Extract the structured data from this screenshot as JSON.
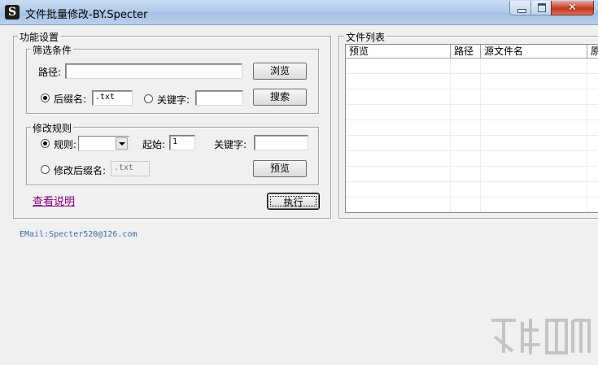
{
  "window": {
    "title": "文件批量修改-BY.Specter",
    "icon": "S-logo-icon",
    "controls": {
      "minimize": "minimize-icon",
      "maximize": "maximize-icon",
      "close": "✕"
    }
  },
  "function_settings": {
    "legend": "功能设置",
    "filter": {
      "legend": "筛选条件",
      "path_label": "路径:",
      "path_value": "",
      "browse_button": "浏览",
      "ext_radio_label": "后缀名:",
      "ext_radio_checked": true,
      "ext_value": ".txt",
      "keyword_radio_label": "关键字:",
      "keyword_radio_checked": false,
      "keyword_value": "",
      "search_button": "搜索"
    },
    "modify": {
      "legend": "修改规则",
      "rule_radio_label": "规则:",
      "rule_radio_checked": true,
      "rule_value": "",
      "start_label": "起始:",
      "start_value": "1",
      "keyword_label": "关键字:",
      "keyword_value": "",
      "ext_radio_label": "修改后缀名:",
      "ext_radio_checked": false,
      "ext_value": ".txt",
      "preview_button": "预览"
    },
    "help_link": "查看说明",
    "execute_button": "执行"
  },
  "email": "EMail:Specter520@126.com",
  "file_list": {
    "legend": "文件列表",
    "columns": [
      "预览",
      "路径",
      "源文件名",
      "原"
    ],
    "rows": []
  }
}
